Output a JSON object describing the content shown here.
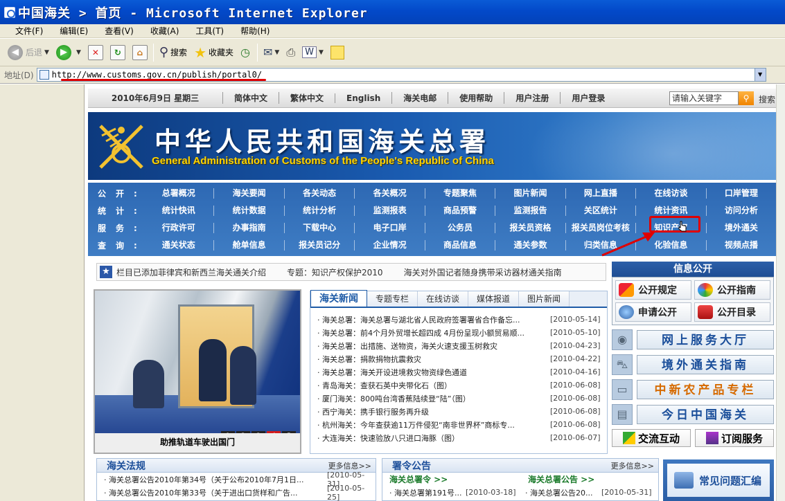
{
  "window": {
    "title": "中国海关 > 首页 - Microsoft Internet Explorer"
  },
  "menu": [
    "文件(F)",
    "编辑(E)",
    "查看(V)",
    "收藏(A)",
    "工具(T)",
    "帮助(H)"
  ],
  "toolbar": {
    "back": "后退",
    "search": "搜索",
    "favorites": "收藏夹"
  },
  "address": {
    "label": "地址(D)",
    "url": "http://www.customs.gov.cn/publish/portal0/"
  },
  "topbar": {
    "date": "2010年6月9日  星期三",
    "links": [
      "简体中文",
      "繁体中文",
      "English",
      "海关电邮",
      "使用帮助",
      "用户注册",
      "用户登录"
    ],
    "search_placeholder": "请输入关键字",
    "search_label": "搜索"
  },
  "banner": {
    "cn": "中华人民共和国海关总署",
    "en": "General Administration of Customs of the People's Republic of China"
  },
  "nav": [
    {
      "cat": "公开:",
      "items": [
        "总署概况",
        "海关要闻",
        "各关动态",
        "各关概况",
        "专题聚焦",
        "图片新闻",
        "网上直播",
        "在线访谈",
        "口岸管理"
      ]
    },
    {
      "cat": "统计:",
      "items": [
        "统计快讯",
        "统计数据",
        "统计分析",
        "监测报表",
        "商品预警",
        "监测报告",
        "关区统计",
        "统计资讯",
        "访问分析"
      ]
    },
    {
      "cat": "服务:",
      "items": [
        "行政许可",
        "办事指南",
        "下载中心",
        "电子口岸",
        "公务员",
        "报关员资格",
        "报关员岗位考核",
        "知识产权",
        "境外通关"
      ]
    },
    {
      "cat": "查询:",
      "items": [
        "通关状态",
        "舱单信息",
        "报关员记分",
        "企业情况",
        "商品信息",
        "通关参数",
        "归类信息",
        "化验信息",
        "视频点播"
      ]
    }
  ],
  "infobar": [
    "栏目已添加菲律宾和新西兰海关通关介绍",
    "专题：知识产权保护2010",
    "海关对外国记者随身携带采访器材通关指南"
  ],
  "photo": {
    "caption": "助推轨道车驶出国门",
    "pages": [
      "1",
      "2",
      "3",
      "4",
      "5"
    ]
  },
  "news": {
    "tabs": [
      "海关新闻",
      "专题专栏",
      "在线访谈",
      "媒体报道",
      "图片新闻"
    ],
    "items": [
      {
        "title": "海关总署：海关总署与湖北省人民政府签署署省合作备忘...",
        "date": "[2010-05-14]"
      },
      {
        "title": "海关总署：前4个月外贸增长超四成 4月份呈现小额贸易顺...",
        "date": "[2010-05-10]"
      },
      {
        "title": "海关总署：出措施、送物资，海关火速支援玉树救灾",
        "date": "[2010-04-23]"
      },
      {
        "title": "海关总署：捐款捐物抗震救灾",
        "date": "[2010-04-22]"
      },
      {
        "title": "海关总署：海关开设进境救灾物资绿色通道",
        "date": "[2010-04-16]"
      },
      {
        "title": "青岛海关：查获石英中夹带化石（图）",
        "date": "[2010-06-08]"
      },
      {
        "title": "厦门海关：800吨台湾香蕉陆续登“陆”（图）",
        "date": "[2010-06-08]"
      },
      {
        "title": "西宁海关：携手银行服务再升级",
        "date": "[2010-06-08]"
      },
      {
        "title": "杭州海关：今年查获逾11万件侵犯“南非世界杯”商标专...",
        "date": "[2010-06-08]"
      },
      {
        "title": "大连海关：快速验放八只进口海豚（图）",
        "date": "[2010-06-07]"
      }
    ]
  },
  "info_public": {
    "title": "信息公开",
    "buttons": [
      "公开规定",
      "公开指南",
      "申请公开",
      "公开目录"
    ]
  },
  "services": [
    "网上服务大厅",
    "境外通关指南",
    "中新农产品专栏",
    "今日中国海关"
  ],
  "exchange": [
    "交流互动",
    "订阅服务"
  ],
  "laws": {
    "title": "海关法规",
    "more": "更多信息>>",
    "items": [
      {
        "title": "海关总署公告2010年第34号（关于公布2010年7月1日...",
        "date": "[2010-05-31]"
      },
      {
        "title": "海关总署公告2010年第33号（关于进出口货样和广告...",
        "date": "[2010-05-25]"
      }
    ]
  },
  "orders": {
    "title": "署令公告",
    "more": "更多信息>>",
    "sub1": "海关总署令 >>",
    "sub2": "海关总署公告 >>",
    "item1": {
      "title": "海关总署第191号...",
      "date": "[2010-03-18]"
    },
    "item2": {
      "title": "海关总署公告20...",
      "date": "[2010-05-31]"
    }
  },
  "faq": {
    "title": "常见问题汇编"
  }
}
